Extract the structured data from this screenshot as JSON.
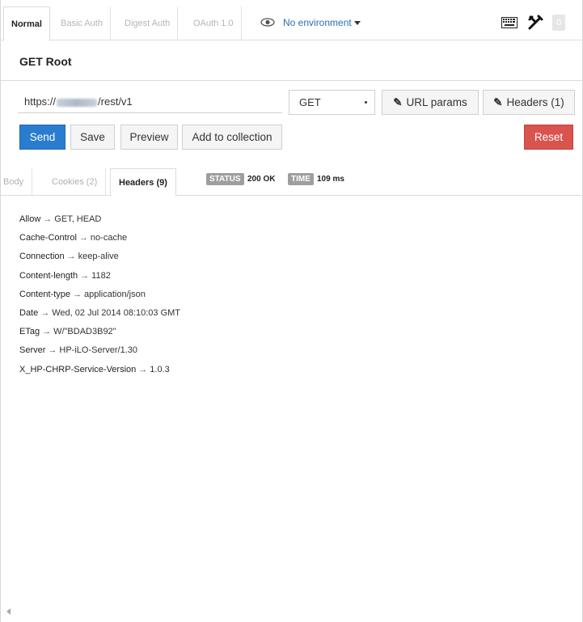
{
  "auth_tabs": [
    "Normal",
    "Basic Auth",
    "Digest Auth",
    "OAuth 1.0"
  ],
  "environment": {
    "label": "No environment"
  },
  "badge_count": "0",
  "request": {
    "title": "GET Root",
    "url_prefix": "https://",
    "url_suffix": "/rest/v1",
    "method": "GET"
  },
  "buttons": {
    "url_params": "URL params",
    "headers": "Headers (1)",
    "send": "Send",
    "save": "Save",
    "preview": "Preview",
    "add_to_collection": "Add to collection",
    "reset": "Reset"
  },
  "response_tabs": [
    "Body",
    "Cookies (2)",
    "Headers (9)"
  ],
  "status": {
    "label": "STATUS",
    "value": "200 OK"
  },
  "time": {
    "label": "TIME",
    "value": "109 ms"
  },
  "response_headers": [
    {
      "key": "Allow",
      "value": "GET, HEAD"
    },
    {
      "key": "Cache-Control",
      "value": "no-cache"
    },
    {
      "key": "Connection",
      "value": "keep-alive"
    },
    {
      "key": "Content-length",
      "value": "1182"
    },
    {
      "key": "Content-type",
      "value": "application/json"
    },
    {
      "key": "Date",
      "value": "Wed, 02 Jul 2014 08:10:03 GMT"
    },
    {
      "key": "ETag",
      "value": "W/\"BDAD3B92\""
    },
    {
      "key": "Server",
      "value": "HP-iLO-Server/1.30"
    },
    {
      "key": "X_HP-CHRP-Service-Version",
      "value": "1.0.3"
    }
  ],
  "colors": {
    "send": "#2a7ccf",
    "reset": "#d9534f",
    "link": "#2a6db8",
    "pill": "#9e9e9e"
  }
}
